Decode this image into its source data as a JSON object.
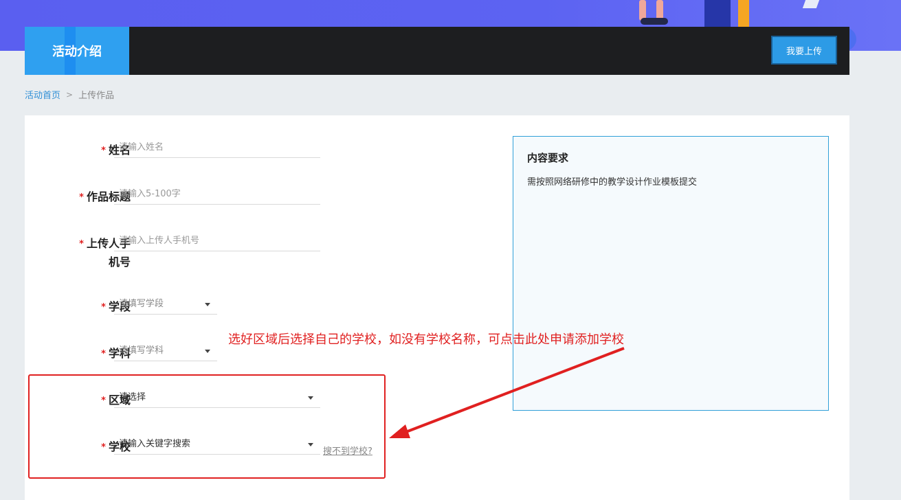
{
  "nav": {
    "tab_label": "活动介绍",
    "upload_button": "我要上传"
  },
  "breadcrumb": {
    "home": "活动首页",
    "separator": ">",
    "current": "上传作品"
  },
  "form": {
    "required_mark": "*",
    "name": {
      "label": "姓名",
      "placeholder": "请输入姓名"
    },
    "title": {
      "label": "作品标题",
      "placeholder": "请输入5-100字"
    },
    "phone": {
      "label_line1": "上传人手",
      "label_line2": "机号",
      "placeholder": "请输入上传人手机号"
    },
    "stage": {
      "label": "学段",
      "placeholder": "请填写学段"
    },
    "subject": {
      "label": "学科",
      "placeholder": "请填写学科"
    },
    "region": {
      "label": "区域",
      "value": "请选择"
    },
    "school": {
      "label": "学校",
      "placeholder": "请输入关键字搜索",
      "cant_find_link": "搜不到学校?"
    }
  },
  "requirements": {
    "title": "内容要求",
    "text": "需按照网络研修中的教学设计作业模板提交"
  },
  "annotation": {
    "text": "选好区域后选择自己的学校，如没有学校名称，可点击此处申请添加学校",
    "color": "#e02020"
  },
  "colors": {
    "accent": "#2fa0f0",
    "navbar": "#1d1e20",
    "hero": "#5a5ff0"
  }
}
